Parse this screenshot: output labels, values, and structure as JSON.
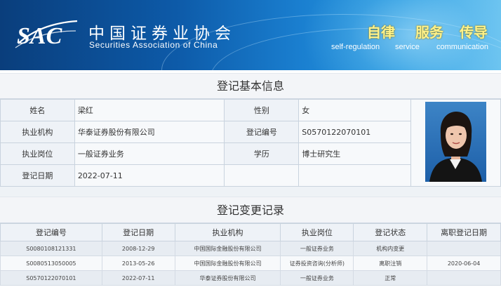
{
  "banner": {
    "logo_text": "SAC",
    "org_name_cn": "中国证券业协会",
    "org_name_en": "Securities Association of China",
    "mottos": [
      {
        "cn": "自律",
        "en": "self-regulation"
      },
      {
        "cn": "服务",
        "en": "service"
      },
      {
        "cn": "传导",
        "en": "communication"
      }
    ],
    "colors": {
      "banner_dark": "#0a3e7c",
      "banner_light": "#6cc4f0",
      "motto": "#fff28a"
    }
  },
  "basic_info": {
    "title": "登记基本信息",
    "fields": {
      "name_label": "姓名",
      "name": "梁红",
      "gender_label": "性别",
      "gender": "女",
      "institution_label": "执业机构",
      "institution": "华泰证券股份有限公司",
      "reg_no_label": "登记编号",
      "reg_no": "S0570122070101",
      "position_label": "执业岗位",
      "position": "一般证券业务",
      "education_label": "学历",
      "education": "博士研究生",
      "reg_date_label": "登记日期",
      "reg_date": "2022-07-11"
    },
    "photo_icon": "person-photo"
  },
  "change_records": {
    "title": "登记变更记录",
    "columns": [
      "登记编号",
      "登记日期",
      "执业机构",
      "执业岗位",
      "登记状态",
      "离职登记日期"
    ],
    "rows": [
      [
        "S0080108121331",
        "2008-12-29",
        "中国国际金融股份有限公司",
        "一般证券业务",
        "机构内变更",
        ""
      ],
      [
        "S0080513050005",
        "2013-05-26",
        "中国国际金融股份有限公司",
        "证券投资咨询(分析师)",
        "离职注销",
        "2020-06-04"
      ],
      [
        "S0570122070101",
        "2022-07-11",
        "华泰证券股份有限公司",
        "一般证券业务",
        "正常",
        ""
      ]
    ]
  }
}
